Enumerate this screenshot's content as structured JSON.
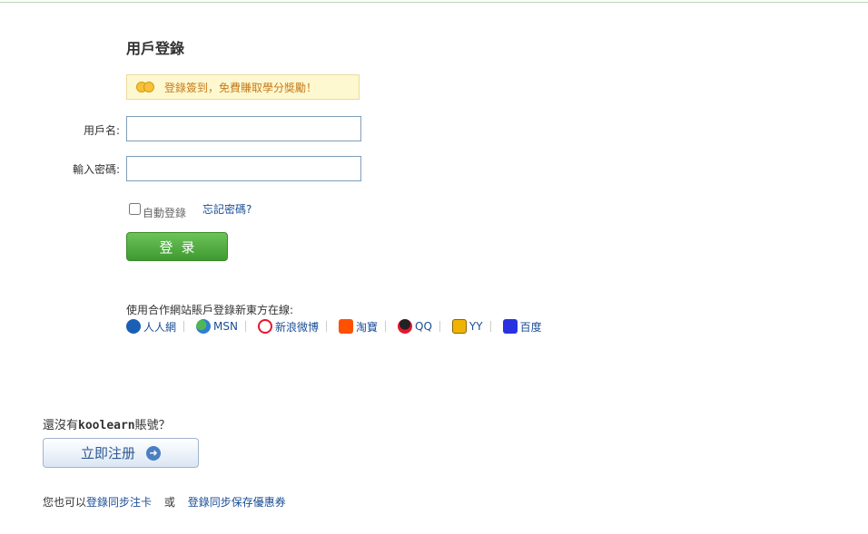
{
  "page": {
    "title": "用戶登錄"
  },
  "notice": {
    "text": "登錄簽到，免費賺取學分獎勵！",
    "icon": "coins-icon"
  },
  "form": {
    "username_label": "用戶名:",
    "username_value": "",
    "password_label": "輸入密碼:",
    "password_value": "",
    "remember_label": "自動登錄",
    "remember_checked": false,
    "forgot_link": "忘記密碼?",
    "login_button": "登录"
  },
  "partners": {
    "title": "使用合作網站賬戶登錄新東方在線:",
    "items": [
      {
        "label": "人人網",
        "icon": "renren-icon",
        "color": "#1a5fb4"
      },
      {
        "label": "MSN",
        "icon": "msn-icon",
        "color": "#3fa34d"
      },
      {
        "label": "新浪微博",
        "icon": "weibo-icon",
        "color": "#e6162d"
      },
      {
        "label": "淘寶",
        "icon": "taobao-icon",
        "color": "#ff5000"
      },
      {
        "label": "QQ",
        "icon": "qq-icon",
        "color": "#222222"
      },
      {
        "label": "YY",
        "icon": "yy-icon",
        "color": "#f0b400"
      },
      {
        "label": "百度",
        "icon": "baidu-icon",
        "color": "#2932e1"
      }
    ]
  },
  "register": {
    "question_prefix": "還沒有",
    "brand": "koolearn",
    "question_suffix": "賬號？",
    "button": "立即注册"
  },
  "footer": {
    "prefix": "您也可以",
    "link1": "登錄同步注卡",
    "or": "或",
    "link2": "登錄同步保存優惠券"
  },
  "colors": {
    "accent_green": "#4caf3a",
    "link_blue": "#1a4e96",
    "notice_text": "#c87a1d"
  }
}
